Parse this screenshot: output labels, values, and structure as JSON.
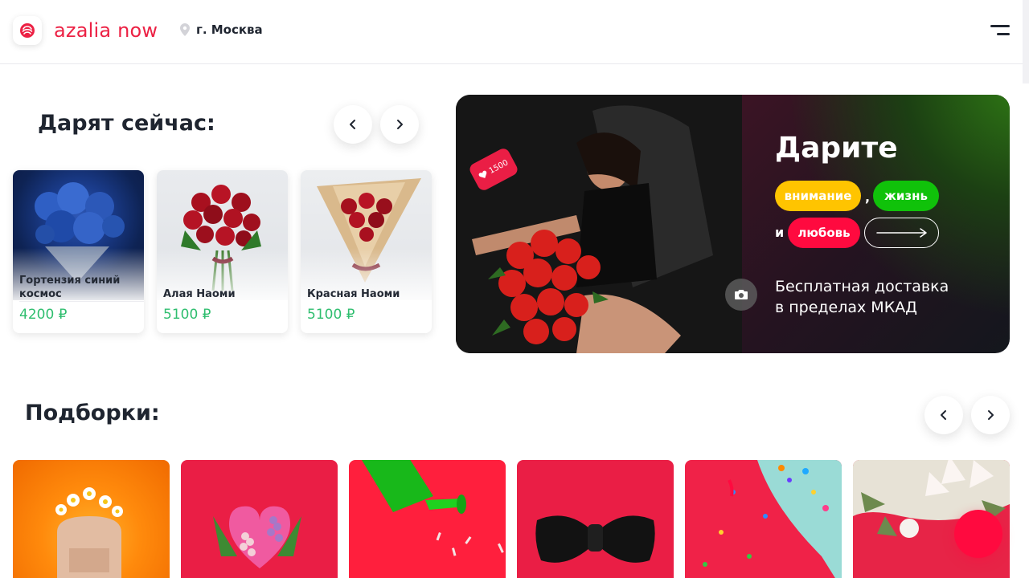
{
  "header": {
    "logo_text": "azalia now",
    "city": "г. Москва",
    "brand_color": "#ec2144"
  },
  "gifting_now": {
    "title": "Дарят сейчас:",
    "products": [
      {
        "name": "Гортензия синий космос",
        "price": "4200 ₽"
      },
      {
        "name": "Алая Наоми",
        "price": "5100 ₽"
      },
      {
        "name": "Красная Наоми",
        "price": "5100 ₽"
      }
    ]
  },
  "banner": {
    "title": "Дарите",
    "pill_attention": "внимание",
    "comma": ",",
    "pill_life": "жизнь",
    "conjunction": "и",
    "pill_love": "любовь",
    "subtitle_line1": "Бесплатная доставка",
    "subtitle_line2": "в пределах МКАД",
    "like_count": "1500",
    "colors": {
      "attention": "#ffc400",
      "life": "#10c20a",
      "love": "#ff0a3f"
    }
  },
  "collections": {
    "title": "Подборки:"
  },
  "icons": {
    "logo": "rose-icon",
    "location": "location-pin-icon",
    "menu": "menu-icon",
    "prev": "chevron-left-icon",
    "next": "chevron-right-icon",
    "camera": "camera-icon",
    "heart": "heart-icon",
    "arrow": "arrow-right-icon"
  },
  "price_color": "#2fbe6f",
  "fab_color": "#ff0a3f"
}
